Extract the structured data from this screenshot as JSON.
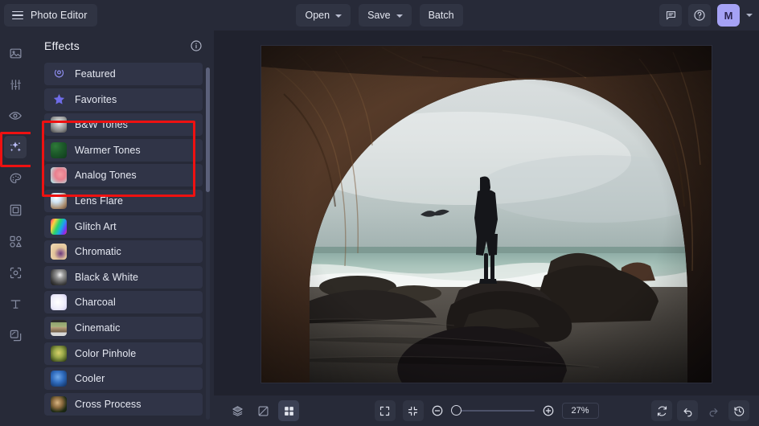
{
  "app": {
    "title": "Photo Editor",
    "menu_icon": "hamburger-icon"
  },
  "topbar": {
    "open_label": "Open",
    "save_label": "Save",
    "batch_label": "Batch",
    "feedback_icon": "comment-icon",
    "help_icon": "help-circle-icon",
    "avatar_initial": "M",
    "accent_color": "#a5a2f5"
  },
  "left_rail": {
    "items": [
      {
        "name": "image-tool",
        "icon": "image-icon",
        "active": false
      },
      {
        "name": "adjust-tool",
        "icon": "sliders-icon",
        "active": false
      },
      {
        "name": "retouch-tool",
        "icon": "eye-icon",
        "active": false
      },
      {
        "name": "effects-tool",
        "icon": "sparkles-icon",
        "active": true,
        "annotated": true
      },
      {
        "name": "color-tool",
        "icon": "palette-icon",
        "active": false
      },
      {
        "name": "frame-tool",
        "icon": "frame-icon",
        "active": false
      },
      {
        "name": "shapes-tool",
        "icon": "shapes-icon",
        "active": false
      },
      {
        "name": "crop-tool",
        "icon": "crop-select-icon",
        "active": false
      },
      {
        "name": "text-tool",
        "icon": "text-icon",
        "active": false
      },
      {
        "name": "layers-tool",
        "icon": "layers-copy-icon",
        "active": false
      }
    ]
  },
  "panel": {
    "title": "Effects",
    "info_icon": "info-circle-icon",
    "annotation_color": "#ee1111",
    "items": [
      {
        "label": "Featured",
        "thumb": "laurel-badge-icon"
      },
      {
        "label": "Favorites",
        "thumb": "star-icon"
      },
      {
        "label": "B&W Tones",
        "thumb": "bw-face-photo"
      },
      {
        "label": "Warmer Tones",
        "thumb": "green-leaf-photo"
      },
      {
        "label": "Analog Tones",
        "thumb": "flamingo-photo"
      },
      {
        "label": "Lens Flare",
        "thumb": "lens-flare-photo"
      },
      {
        "label": "Glitch Art",
        "thumb": "glitch-face-photo"
      },
      {
        "label": "Chromatic",
        "thumb": "chromatic-photo"
      },
      {
        "label": "Black & White",
        "thumb": "bw-moon-photo"
      },
      {
        "label": "Charcoal",
        "thumb": "charcoal-sketch-photo"
      },
      {
        "label": "Cinematic",
        "thumb": "cinematic-strip-photo"
      },
      {
        "label": "Color Pinhole",
        "thumb": "pinhole-photo"
      },
      {
        "label": "Cooler",
        "thumb": "cool-blue-photo"
      },
      {
        "label": "Cross Process",
        "thumb": "cross-process-photo"
      }
    ]
  },
  "canvas": {
    "photo_alt": "person standing on rocks seen through a sea cave arch"
  },
  "bottombar": {
    "layers_icon": "layers-stack-icon",
    "compare_icon": "compare-split-icon",
    "grid_icon": "grid-view-icon",
    "fit_icon": "fit-screen-icon",
    "shrink_icon": "shrink-icon",
    "zoom_out_icon": "zoom-out-icon",
    "zoom_in_icon": "zoom-in-icon",
    "zoom_value": "27%",
    "reset_icon": "reset-rotate-icon",
    "undo_icon": "undo-icon",
    "redo_icon": "redo-icon",
    "history_icon": "history-clock-icon"
  }
}
